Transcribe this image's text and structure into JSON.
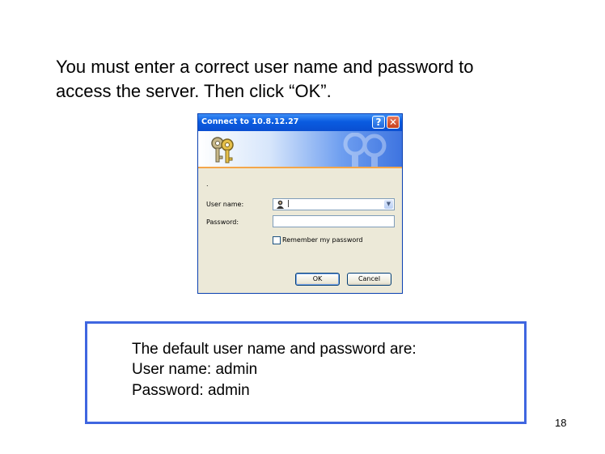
{
  "instruction": {
    "line1": "You must enter a correct user name and password to",
    "line2": "access the server. Then click “OK”."
  },
  "dialog": {
    "title": "Connect to 10.8.12.27",
    "help_button": "?",
    "close_button": "✕",
    "dot_text": ".",
    "username_label": "User name:",
    "username_value": "|",
    "password_label": "Password:",
    "password_value": "",
    "remember_label": "Remember my password",
    "remember_checked": false,
    "ok_button": "OK",
    "cancel_button": "Cancel",
    "icons": {
      "banner": "keys-icon",
      "user": "user-icon",
      "dropdown": "chevron-down-icon"
    }
  },
  "info": {
    "line1": "The default user name and password are:",
    "line2": "User name: admin",
    "line3": "Password: admin"
  },
  "page_number": "18",
  "colors": {
    "titlebar": "#0a4fd1",
    "banner_stripe": "#f4a64a",
    "info_border": "#3f66e0"
  }
}
